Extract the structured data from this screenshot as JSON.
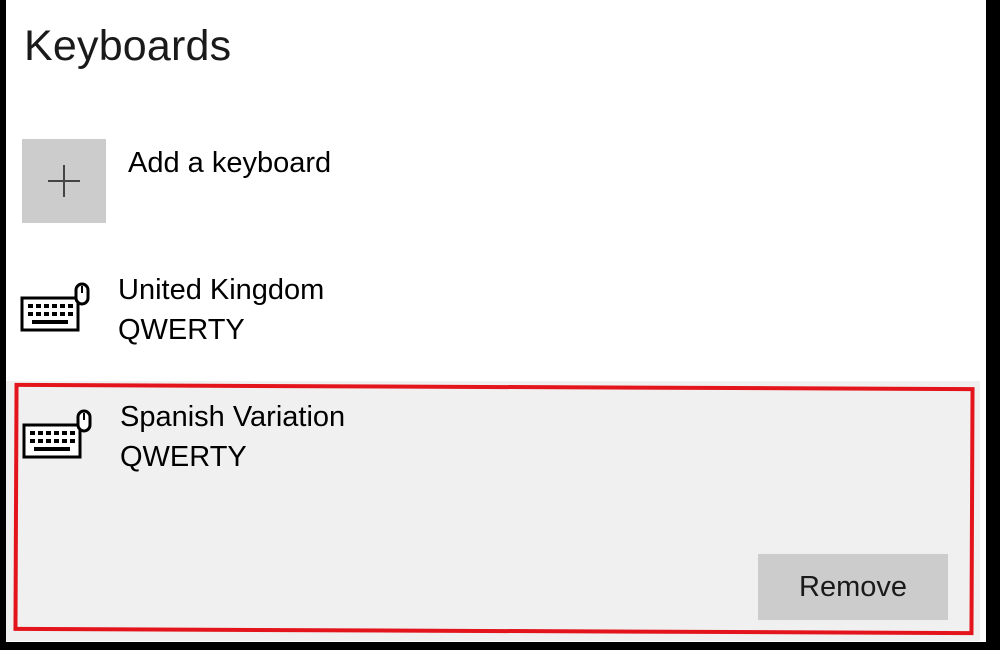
{
  "page": {
    "title": "Keyboards"
  },
  "add_keyboard": {
    "label": "Add a keyboard",
    "icon": "plus-icon"
  },
  "keyboards": [
    {
      "name": "United Kingdom",
      "layout": "QWERTY",
      "icon": "keyboard-icon",
      "selected": false
    },
    {
      "name": "Spanish Variation",
      "layout": "QWERTY",
      "icon": "keyboard-icon",
      "selected": true
    }
  ],
  "actions": {
    "remove_label": "Remove"
  },
  "colors": {
    "tile_bg": "#cccccc",
    "selected_bg": "#f0f0f0",
    "highlight": "#e3141c"
  }
}
